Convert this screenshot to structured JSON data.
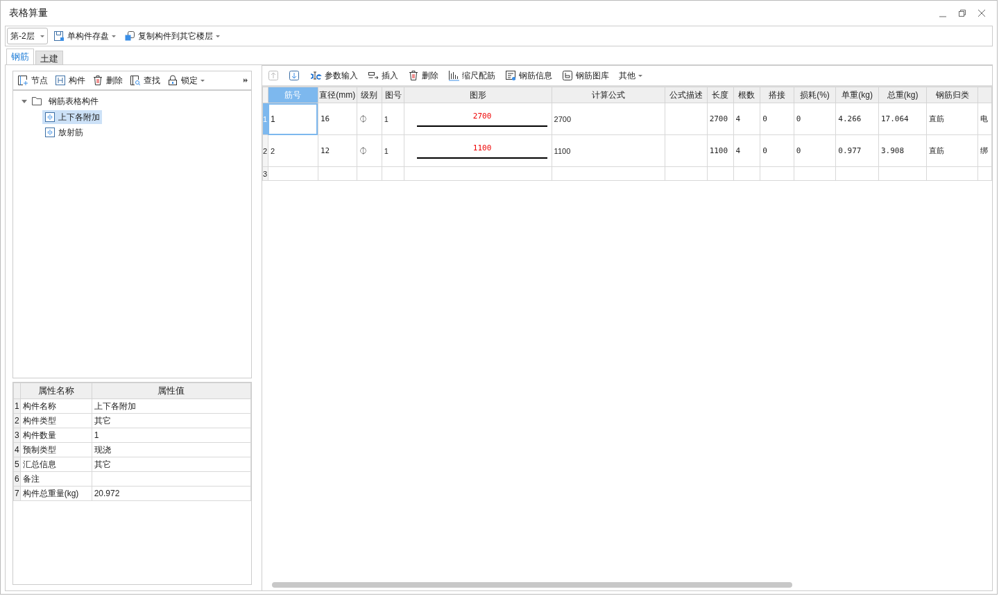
{
  "window": {
    "title": "表格算量"
  },
  "toolbar": {
    "floor": "第-2层",
    "items": [
      {
        "kind": "save",
        "label": "单构件存盘"
      },
      {
        "kind": "copy",
        "label": "复制构件到其它楼层"
      }
    ]
  },
  "tabs": [
    {
      "label": "钢筋",
      "selected": true
    },
    {
      "label": "土建",
      "selected": false
    }
  ],
  "tree_toolbar": [
    {
      "kind": "node",
      "label": "节点"
    },
    {
      "kind": "part",
      "label": "构件"
    },
    {
      "kind": "delete",
      "label": "删除"
    },
    {
      "kind": "find",
      "label": "查找"
    },
    {
      "kind": "lock",
      "label": "锁定"
    }
  ],
  "tree": [
    {
      "label": "钢筋表格构件",
      "expanded": true,
      "selected": false,
      "children": [
        {
          "label": "上下各附加",
          "selected": true
        },
        {
          "label": "放射筋",
          "selected": false
        }
      ]
    }
  ],
  "properties": {
    "columns": [
      "属性名称",
      "属性值"
    ],
    "rows": [
      {
        "index": "1",
        "name": "构件名称",
        "value": "上下各附加"
      },
      {
        "index": "2",
        "name": "构件类型",
        "value": "其它"
      },
      {
        "index": "3",
        "name": "构件数量",
        "value": "1"
      },
      {
        "index": "4",
        "name": "预制类型",
        "value": "现浇"
      },
      {
        "index": "5",
        "name": "汇总信息",
        "value": "其它"
      },
      {
        "index": "6",
        "name": "备注",
        "value": ""
      },
      {
        "index": "7",
        "name": "构件总重量(kg)",
        "value": "20.972"
      }
    ]
  },
  "grid_toolbar": [
    {
      "kind": "up",
      "disabled": true
    },
    {
      "kind": "down",
      "disabled": false
    },
    {
      "kind": "param",
      "label": "参数输入",
      "disabled": false
    },
    {
      "kind": "insert",
      "label": "插入",
      "disabled": false
    },
    {
      "kind": "delete",
      "label": "删除",
      "disabled": false
    },
    {
      "kind": "scale",
      "label": "缩尺配筋",
      "disabled": false
    },
    {
      "kind": "info",
      "label": "钢筋信息",
      "disabled": false
    },
    {
      "kind": "library",
      "label": "钢筋图库",
      "disabled": false
    },
    {
      "kind": "more",
      "label": "其他",
      "disabled": false
    }
  ],
  "grid": {
    "columns": [
      "筋号",
      "直径(mm)",
      "级别",
      "图号",
      "图形",
      "计算公式",
      "公式描述",
      "长度",
      "根数",
      "搭接",
      "损耗(%)",
      "单重(kg)",
      "总重(kg)",
      "钢筋归类",
      ""
    ],
    "rows": [
      {
        "index": "1",
        "selected": true,
        "cells": [
          "1",
          "16",
          "⏀",
          "1",
          "2700",
          "2700",
          "",
          "2700",
          "4",
          "0",
          "0",
          "4.266",
          "17.064",
          "直筋",
          "电"
        ]
      },
      {
        "index": "2",
        "selected": false,
        "cells": [
          "2",
          "12",
          "⏀",
          "1",
          "1100",
          "1100",
          "",
          "1100",
          "4",
          "0",
          "0",
          "0.977",
          "3.908",
          "直筋",
          "绑"
        ]
      },
      {
        "index": "3",
        "selected": false,
        "cells": [
          "",
          "",
          "",
          "",
          "",
          "",
          "",
          "",
          "",
          "",
          "",
          "",
          "",
          "",
          ""
        ]
      }
    ]
  }
}
